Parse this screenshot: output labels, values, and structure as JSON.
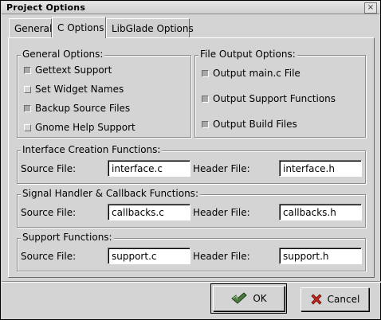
{
  "window": {
    "title": "Project Options",
    "close_glyph": "×"
  },
  "tabs": [
    {
      "label": "General",
      "active": false
    },
    {
      "label": "C Options",
      "active": true
    },
    {
      "label": "LibGlade Options",
      "active": false
    }
  ],
  "general_options": {
    "title": "General Options:",
    "items": [
      {
        "label": "Gettext Support",
        "checked": true
      },
      {
        "label": "Set Widget Names",
        "checked": false
      },
      {
        "label": "Backup Source Files",
        "checked": true
      },
      {
        "label": "Gnome Help Support",
        "checked": false
      }
    ]
  },
  "file_output_options": {
    "title": "File Output Options:",
    "items": [
      {
        "label": "Output main.c File",
        "checked": true
      },
      {
        "label": "Output Support Functions",
        "checked": true
      },
      {
        "label": "Output Build Files",
        "checked": true
      }
    ]
  },
  "sections": [
    {
      "title": "Interface Creation Functions:",
      "source_label": "Source File:",
      "source_value": "interface.c",
      "header_label": "Header File:",
      "header_value": "interface.h"
    },
    {
      "title": "Signal Handler & Callback Functions:",
      "source_label": "Source File:",
      "source_value": "callbacks.c",
      "header_label": "Header File:",
      "header_value": "callbacks.h"
    },
    {
      "title": "Support Functions:",
      "source_label": "Source File:",
      "source_value": "support.c",
      "header_label": "Header File:",
      "header_value": "support.h"
    }
  ],
  "buttons": {
    "ok": {
      "label": "OK",
      "icon": "ok-check-icon"
    },
    "cancel": {
      "label": "Cancel",
      "icon": "cancel-x-icon"
    }
  },
  "colors": {
    "ok_icon": "#4a7a3c",
    "cancel_icon": "#c0261c"
  }
}
